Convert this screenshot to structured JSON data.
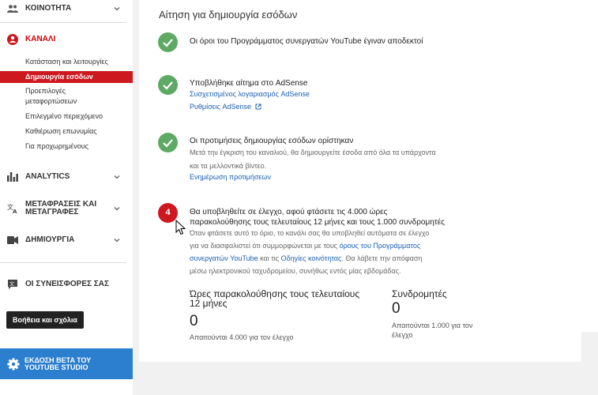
{
  "sidebar": {
    "community": "ΚΟΙΝΟΤΗΤΑ",
    "channel": "ΚΑΝΑΛΙ",
    "channel_items": [
      "Κατάσταση και λειτουργίες",
      "Δημιουργία εσόδων",
      "Προεπιλογές",
      "μεταφορτώσεων",
      "Επιλεγμένο περιεχόμενο",
      "Καθιέρωση επωνυμίας",
      "Για προχωρημένους"
    ],
    "analytics": "ANALYTICS",
    "translations_1": "ΜΕΤΑΦΡΑΣΕΙΣ ΚΑΙ",
    "translations_2": "ΜΕΤΑΓΡΑΦΕΣ",
    "create": "ΔΗΜΙΟΥΡΓΙΑ",
    "contributions": "ΟΙ ΣΥΝΕΙΣΦΟΡΕΣ ΣΑΣ",
    "help_button": "Βοήθεια και σχόλια",
    "beta_1": "ΕΚΔΟΣΗ BETA ΤΟΥ",
    "beta_2": "YOUTUBE STUDIO"
  },
  "main": {
    "title": "Αίτηση για δημιουργία εσόδων",
    "step1": "Οι όροι του Προγράμματος συνεργατών YouTube έγιναν αποδεκτοί",
    "step2": "Υποβλήθηκε αίτημα στο AdSense",
    "step2_link1": "Συσχετισμένος λογαριασμός AdSense",
    "step2_link2": "Ρυθμίσεις AdSense",
    "step3": "Οι προτιμήσεις δημιουργίας εσόδων ορίστηκαν",
    "step3_desc1": "Μετά την έγκριση του καναλιού, θα δημιουργείτε έσοδα από όλα τα υπάρχοντα",
    "step3_desc2": "και τα μελλοντικά βίντεο.",
    "step3_link": "Ενημέρωση προτιμήσεων",
    "step4_number": "4",
    "step4_1": "Θα υποβληθείτε σε έλεγχο, αφού φτάσετε τις 4.000 ώρες",
    "step4_2": "παρακολούθησης τους τελευταίους 12 μήνες και τους 1.000 συνδρομητές",
    "step4_desc1": "Όταν φτάσετε αυτό το όριο, το κανάλι σας θα υποβληθεί αυτόματα σε έλεγχο",
    "step4_desc2a": "για να διασφαλιστεί ότι συμμορφώνεται με τους ",
    "step4_desc2_link": "όρους του Προγράμματος",
    "step4_desc3_link": "συνεργατών YouTube",
    "step4_desc3b": " και τις ",
    "step4_desc3_link2": "Οδηγίες κοινότητας",
    "step4_desc3c": ". Θα λάβετε την απόφαση",
    "step4_desc4": "μέσω ηλεκτρονικού ταχυδρομείου, συνήθως εντός μίας εβδομάδας.",
    "watch_label1": "Ώρες παρακολούθησης τους τελευταίους",
    "watch_label2": "12 μήνες",
    "watch_value": "0",
    "watch_note": "Απαιτούνται 4.000 για τον έλεγχο",
    "subs_label": "Συνδρομητές",
    "subs_value": "0",
    "subs_note1": "Απαιτούνται 1.000 για τον",
    "subs_note2": "έλεγχο"
  },
  "colors": {
    "accent_red": "#cc181e",
    "success_green": "#5eaa64",
    "link_blue": "#1a5fb4",
    "beta_blue": "#2c7ecf"
  }
}
